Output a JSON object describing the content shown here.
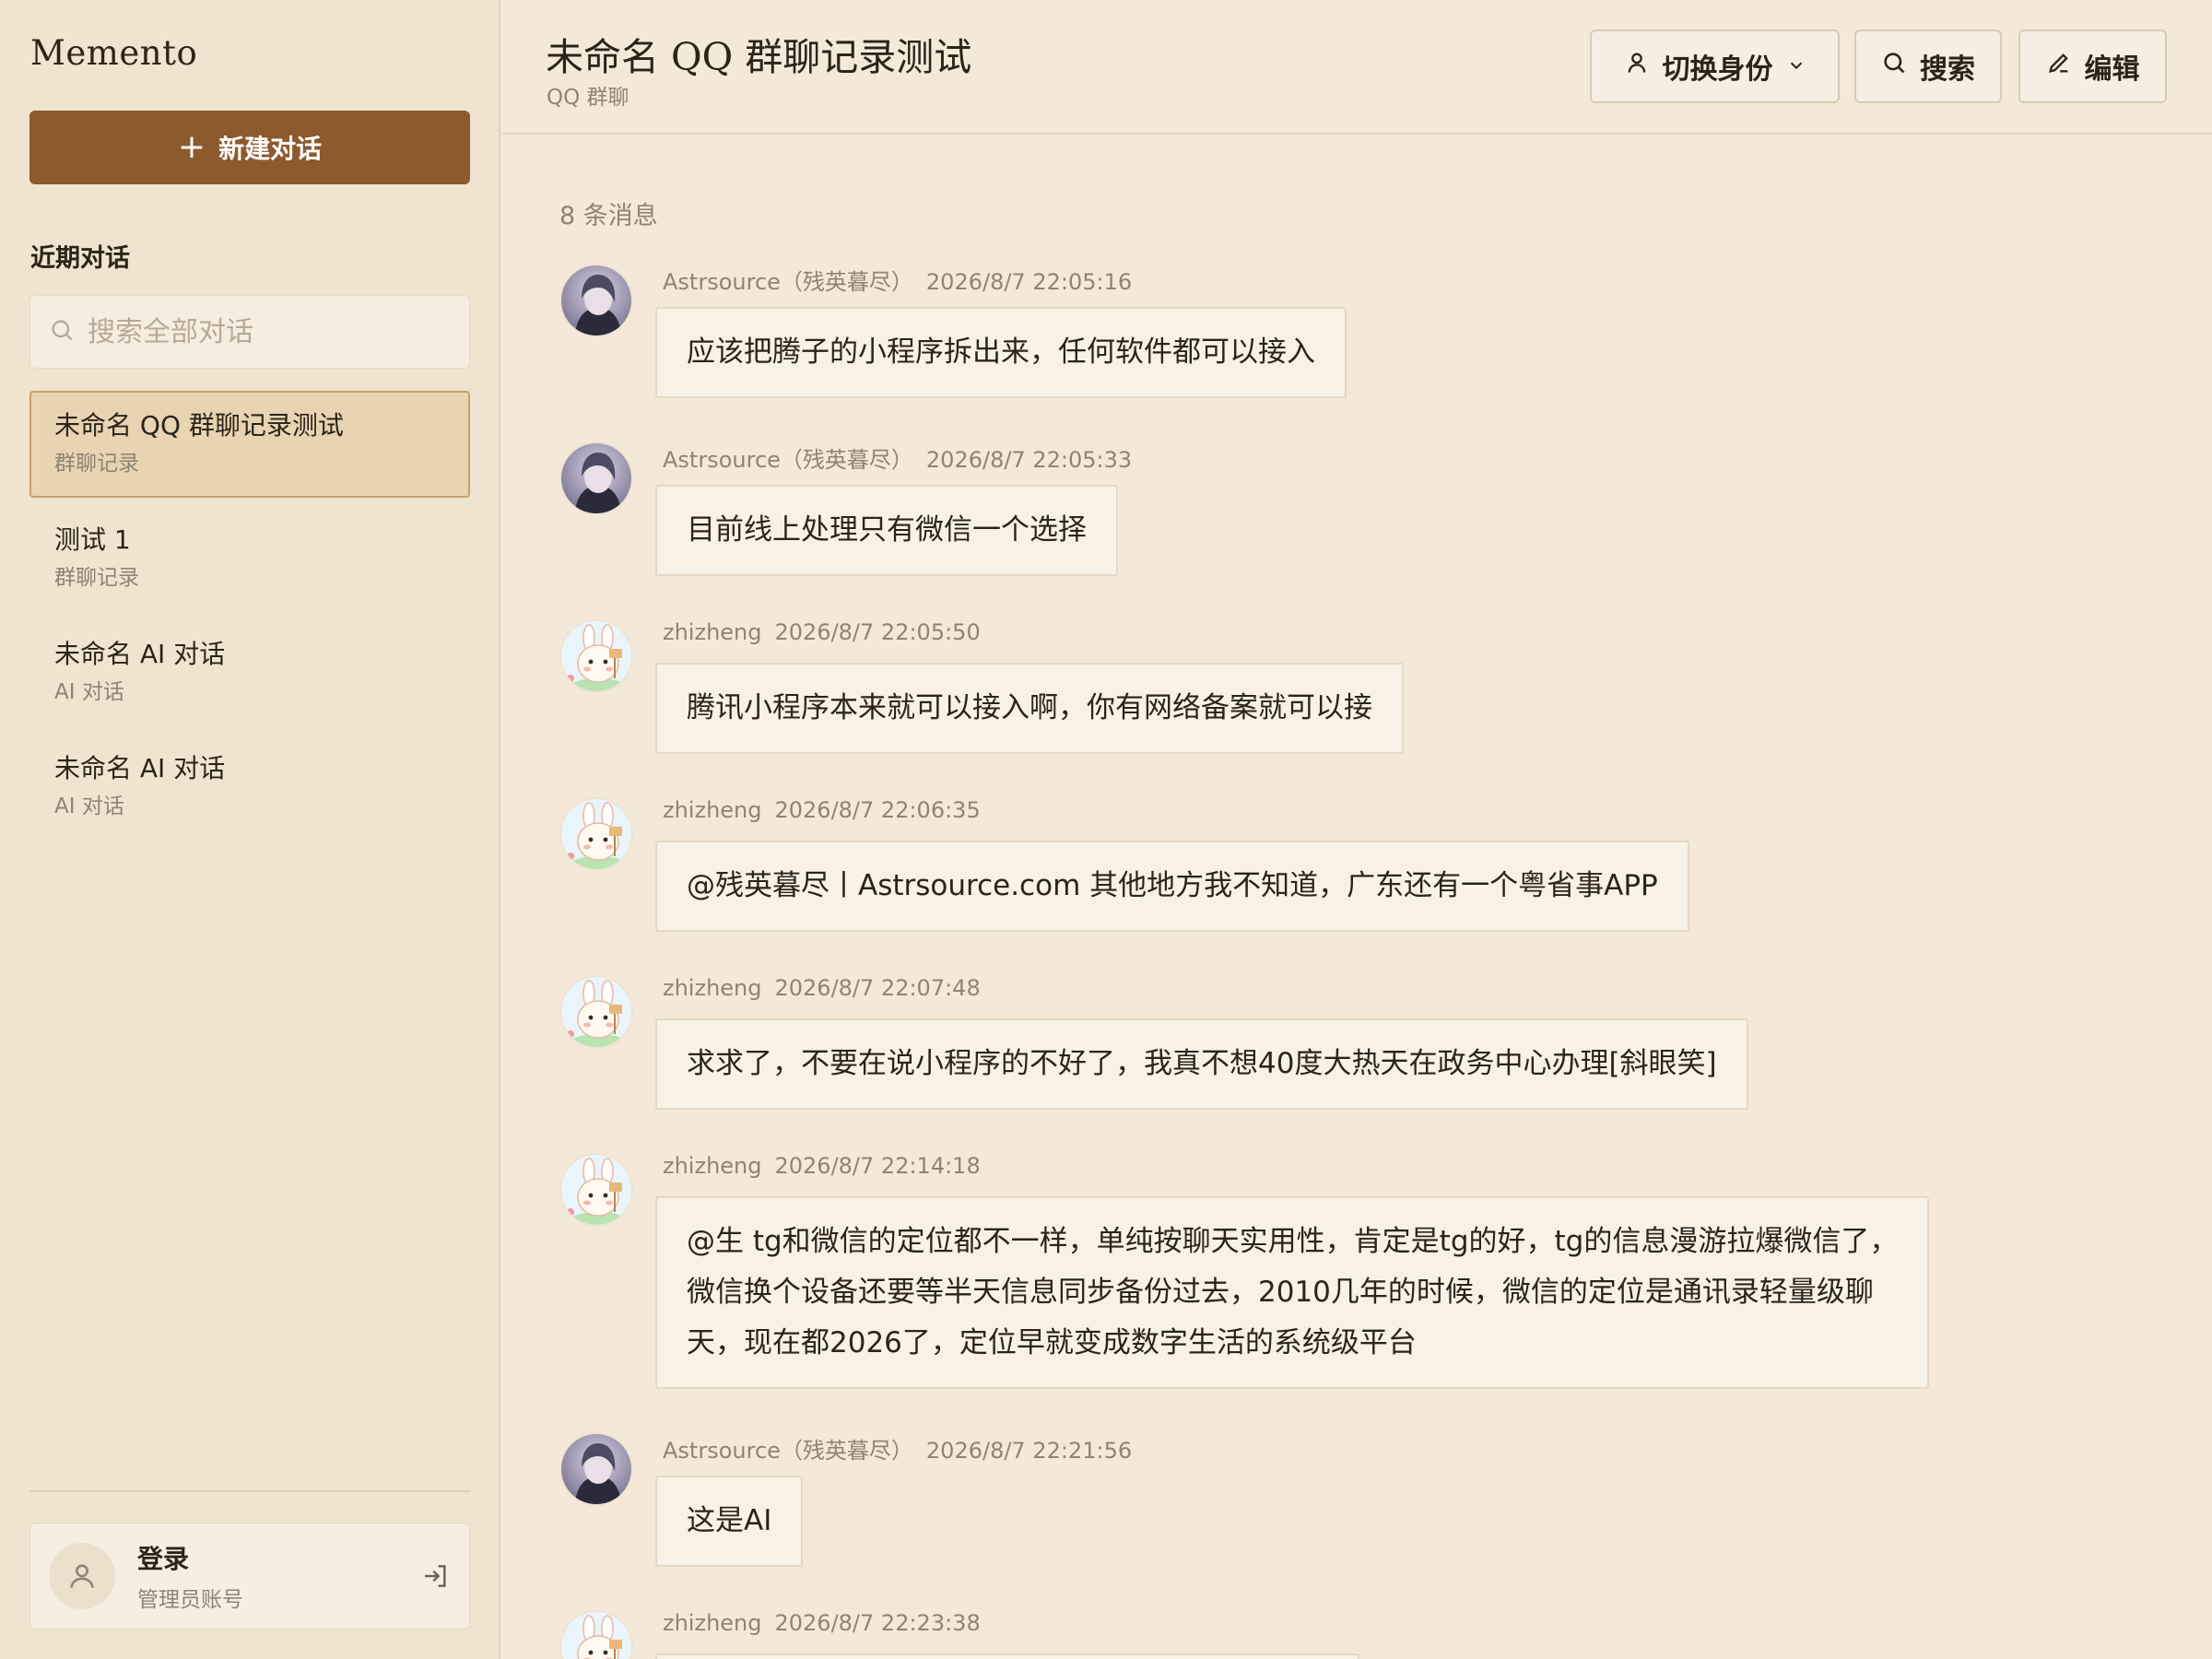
{
  "sidebar": {
    "brand": "Memento",
    "new_chat_label": "新建对话",
    "recent_title": "近期对话",
    "search_placeholder": "搜索全部对话",
    "items": [
      {
        "title": "未命名 QQ 群聊记录测试",
        "subtitle": "群聊记录",
        "active": true
      },
      {
        "title": "测试 1",
        "subtitle": "群聊记录",
        "active": false
      },
      {
        "title": "未命名 AI 对话",
        "subtitle": "AI 对话",
        "active": false
      },
      {
        "title": "未命名 AI 对话",
        "subtitle": "AI 对话",
        "active": false
      }
    ],
    "login": {
      "title": "登录",
      "subtitle": "管理员账号"
    }
  },
  "header": {
    "title": "未命名 QQ 群聊记录测试",
    "subtitle": "QQ 群聊",
    "switch_identity_label": "切换身份",
    "search_label": "搜索",
    "edit_label": "编辑"
  },
  "conversation": {
    "message_count": "8 条消息",
    "messages": [
      {
        "sender": "Astrsource（残英暮尽）",
        "time": "2026/8/7 22:05:16",
        "avatar": "astrsource",
        "lines": [
          "应该把腾子的小程序拆出来，任何软件都可以接入"
        ]
      },
      {
        "sender": "Astrsource（残英暮尽）",
        "time": "2026/8/7 22:05:33",
        "avatar": "astrsource",
        "lines": [
          "目前线上处理只有微信一个选择"
        ]
      },
      {
        "sender": "zhizheng",
        "time": "2026/8/7 22:05:50",
        "avatar": "zhizheng",
        "lines": [
          "腾讯小程序本来就可以接入啊，你有网络备案就可以接"
        ]
      },
      {
        "sender": "zhizheng",
        "time": "2026/8/7 22:06:35",
        "avatar": "zhizheng",
        "lines": [
          "@残英暮尽丨Astrsource.com 其他地方我不知道，广东还有一个粤省事APP"
        ]
      },
      {
        "sender": "zhizheng",
        "time": "2026/8/7 22:07:48",
        "avatar": "zhizheng",
        "lines": [
          "求求了，不要在说小程序的不好了，我真不想40度大热天在政务中心办理[斜眼笑]"
        ]
      },
      {
        "sender": "zhizheng",
        "time": "2026/8/7 22:14:18",
        "avatar": "zhizheng",
        "lines": [
          "@生 tg和微信的定位都不一样，单纯按聊天实用性，肯定是tg的好，tg的信息漫游拉爆微信了，",
          "微信换个设备还要等半天信息同步备份过去，2010几年的时候，微信的定位是通讯录轻量级聊",
          "天，现在都2026了，定位早就变成数字生活的系统级平台"
        ]
      },
      {
        "sender": "Astrsource（残英暮尽）",
        "time": "2026/8/7 22:21:56",
        "avatar": "astrsource",
        "lines": [
          "这是AI"
        ]
      },
      {
        "sender": "zhizheng",
        "time": "2026/8/7 22:23:38",
        "avatar": "zhizheng",
        "lines": [
          ""
        ]
      }
    ]
  },
  "colors": {
    "background": "#f4e9d8",
    "sidebar": "#f0e4d0",
    "accent": "#8d5a2d",
    "active_item": "#e8d4b2",
    "bubble": "#f8f1e6",
    "muted_text": "#8f8473"
  }
}
